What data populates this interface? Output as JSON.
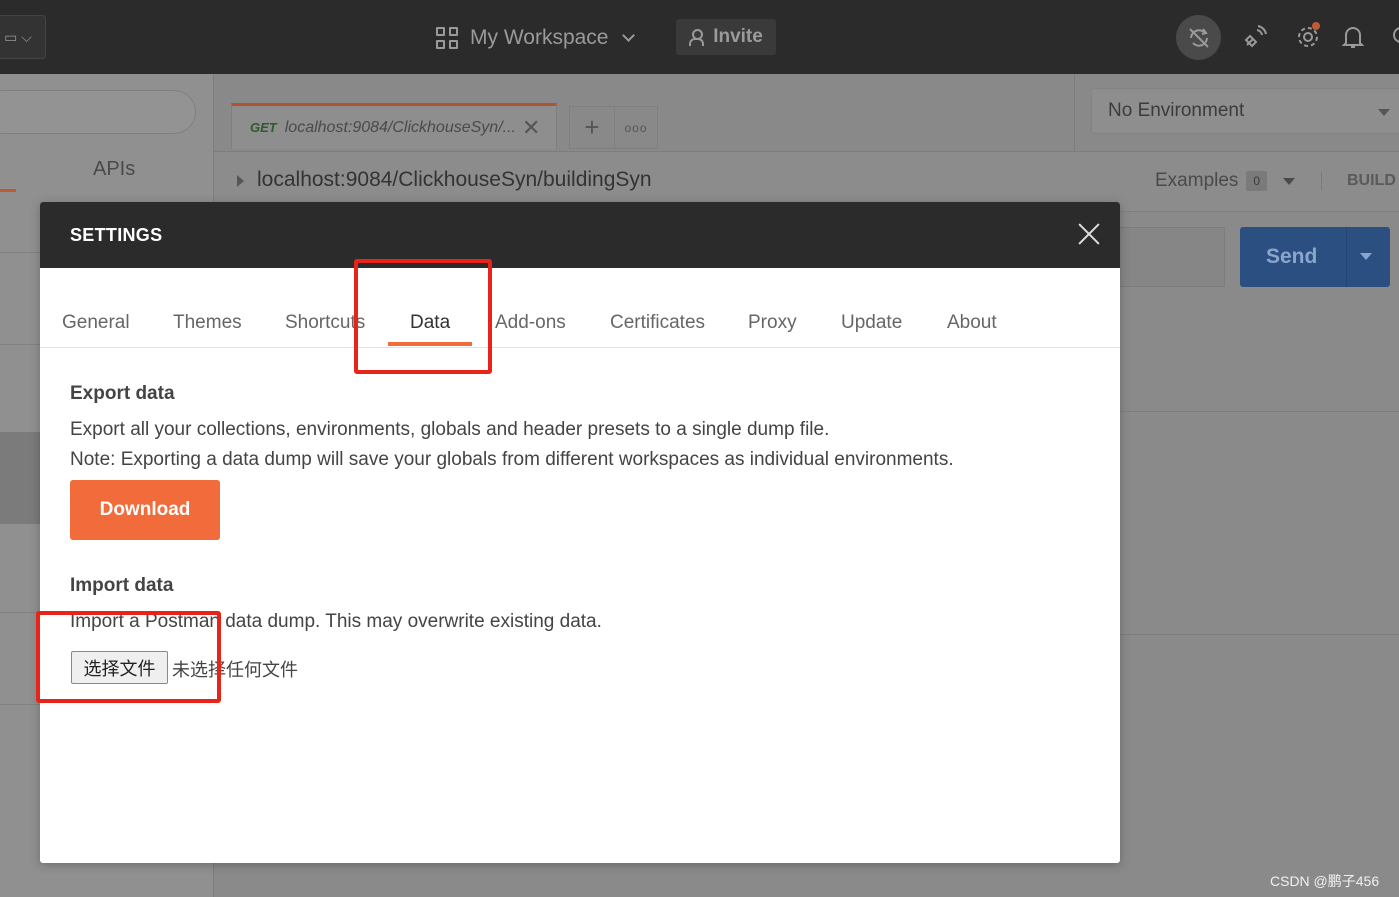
{
  "topbar": {
    "workspace_label": "My Workspace",
    "invite_label": "Invite"
  },
  "sidebar": {
    "apis_tab": "APIs"
  },
  "request_tab": {
    "method": "GET",
    "title": "localhost:9084/ClickhouseSyn/...",
    "close": "✕",
    "add": "+",
    "more": "ooo"
  },
  "environment": {
    "selected": "No Environment"
  },
  "request": {
    "url_name": "localhost:9084/ClickhouseSyn/buildingSyn",
    "examples_label": "Examples",
    "examples_count": "0",
    "build_label": "BUILD",
    "send_label": "Send"
  },
  "settings": {
    "title": "SETTINGS",
    "tabs": [
      "General",
      "Themes",
      "Shortcuts",
      "Data",
      "Add-ons",
      "Certificates",
      "Proxy",
      "Update",
      "About"
    ],
    "active_tab": "Data",
    "export": {
      "title": "Export data",
      "line1": "Export all your collections, environments, globals and header presets to a single dump file.",
      "line2": "Note: Exporting a data dump will save your globals from different workspaces as individual environments.",
      "button": "Download"
    },
    "import": {
      "title": "Import data",
      "description": "Import a Postman data dump. This may overwrite existing data.",
      "file_button": "选择文件",
      "file_status": "未选择任何文件"
    }
  },
  "watermark": "CSDN @鹏子456",
  "colors": {
    "accent_orange": "#f26b3a",
    "header_dark": "#2b2b2b",
    "annotation_red": "#e8231a"
  }
}
